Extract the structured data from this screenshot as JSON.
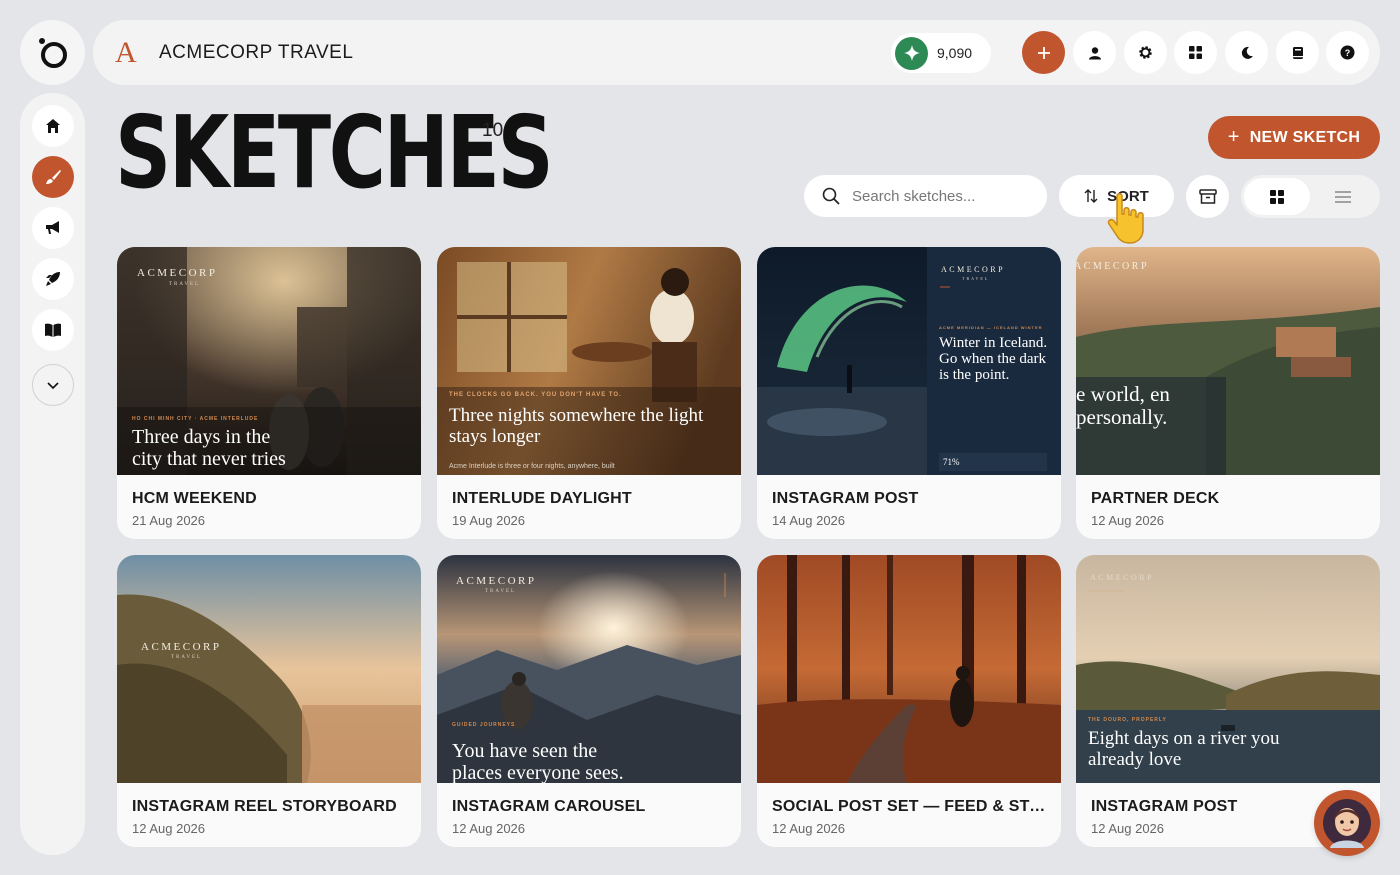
{
  "header": {
    "brand_mark": "A",
    "brand_name": "ACMECORP TRAVEL",
    "credits": "9,090"
  },
  "page": {
    "title": "SKETCHES",
    "count": "10",
    "new_button": "NEW SKETCH",
    "search_placeholder": "Search sketches...",
    "sort_label": "SORT"
  },
  "cards": [
    {
      "title": "HCM WEEKEND",
      "date": "21 Aug 2026",
      "brand": "ACMECORP",
      "brand_sub": "TRAVEL",
      "eyebrow": "HO CHI MINH CITY · ACME INTERLUDE",
      "headline": "Three days in the city that never tries"
    },
    {
      "title": "INTERLUDE DAYLIGHT",
      "date": "19 Aug 2026",
      "eyebrow": "THE CLOCKS GO BACK. YOU DON'T HAVE TO.",
      "headline": "Three nights somewhere the light stays longer",
      "body": "Acme Interlude is three or four nights, anywhere, built"
    },
    {
      "title": "INSTAGRAM POST",
      "date": "14 Aug 2026",
      "brand": "ACMECORP",
      "brand_sub": "TRAVEL",
      "eyebrow": "ACME MERIDIAN — ICELAND WINTER",
      "headline": "Winter in Iceland. Go when the dark is the point.",
      "stat": "71%"
    },
    {
      "title": "PARTNER DECK",
      "date": "12 Aug 2026",
      "brand": "ACMECORP",
      "headline": "e world, en personally."
    },
    {
      "title": "INSTAGRAM REEL STORYBOARD",
      "date": "12 Aug 2026",
      "brand": "ACMECORP",
      "brand_sub": "TRAVEL"
    },
    {
      "title": "INSTAGRAM CAROUSEL",
      "date": "12 Aug 2026",
      "brand": "ACMECORP",
      "brand_sub": "TRAVEL",
      "eyebrow": "GUIDED JOURNEYS",
      "headline": "You have seen the places everyone sees."
    },
    {
      "title": "SOCIAL POST SET — FEED & STORY ...",
      "date": "12 Aug 2026"
    },
    {
      "title": "INSTAGRAM POST",
      "date": "12 Aug 2026",
      "brand": "ACMECORP",
      "eyebrow": "THE DOURO, PROPERLY",
      "headline": "Eight days on a river you already love"
    }
  ]
}
